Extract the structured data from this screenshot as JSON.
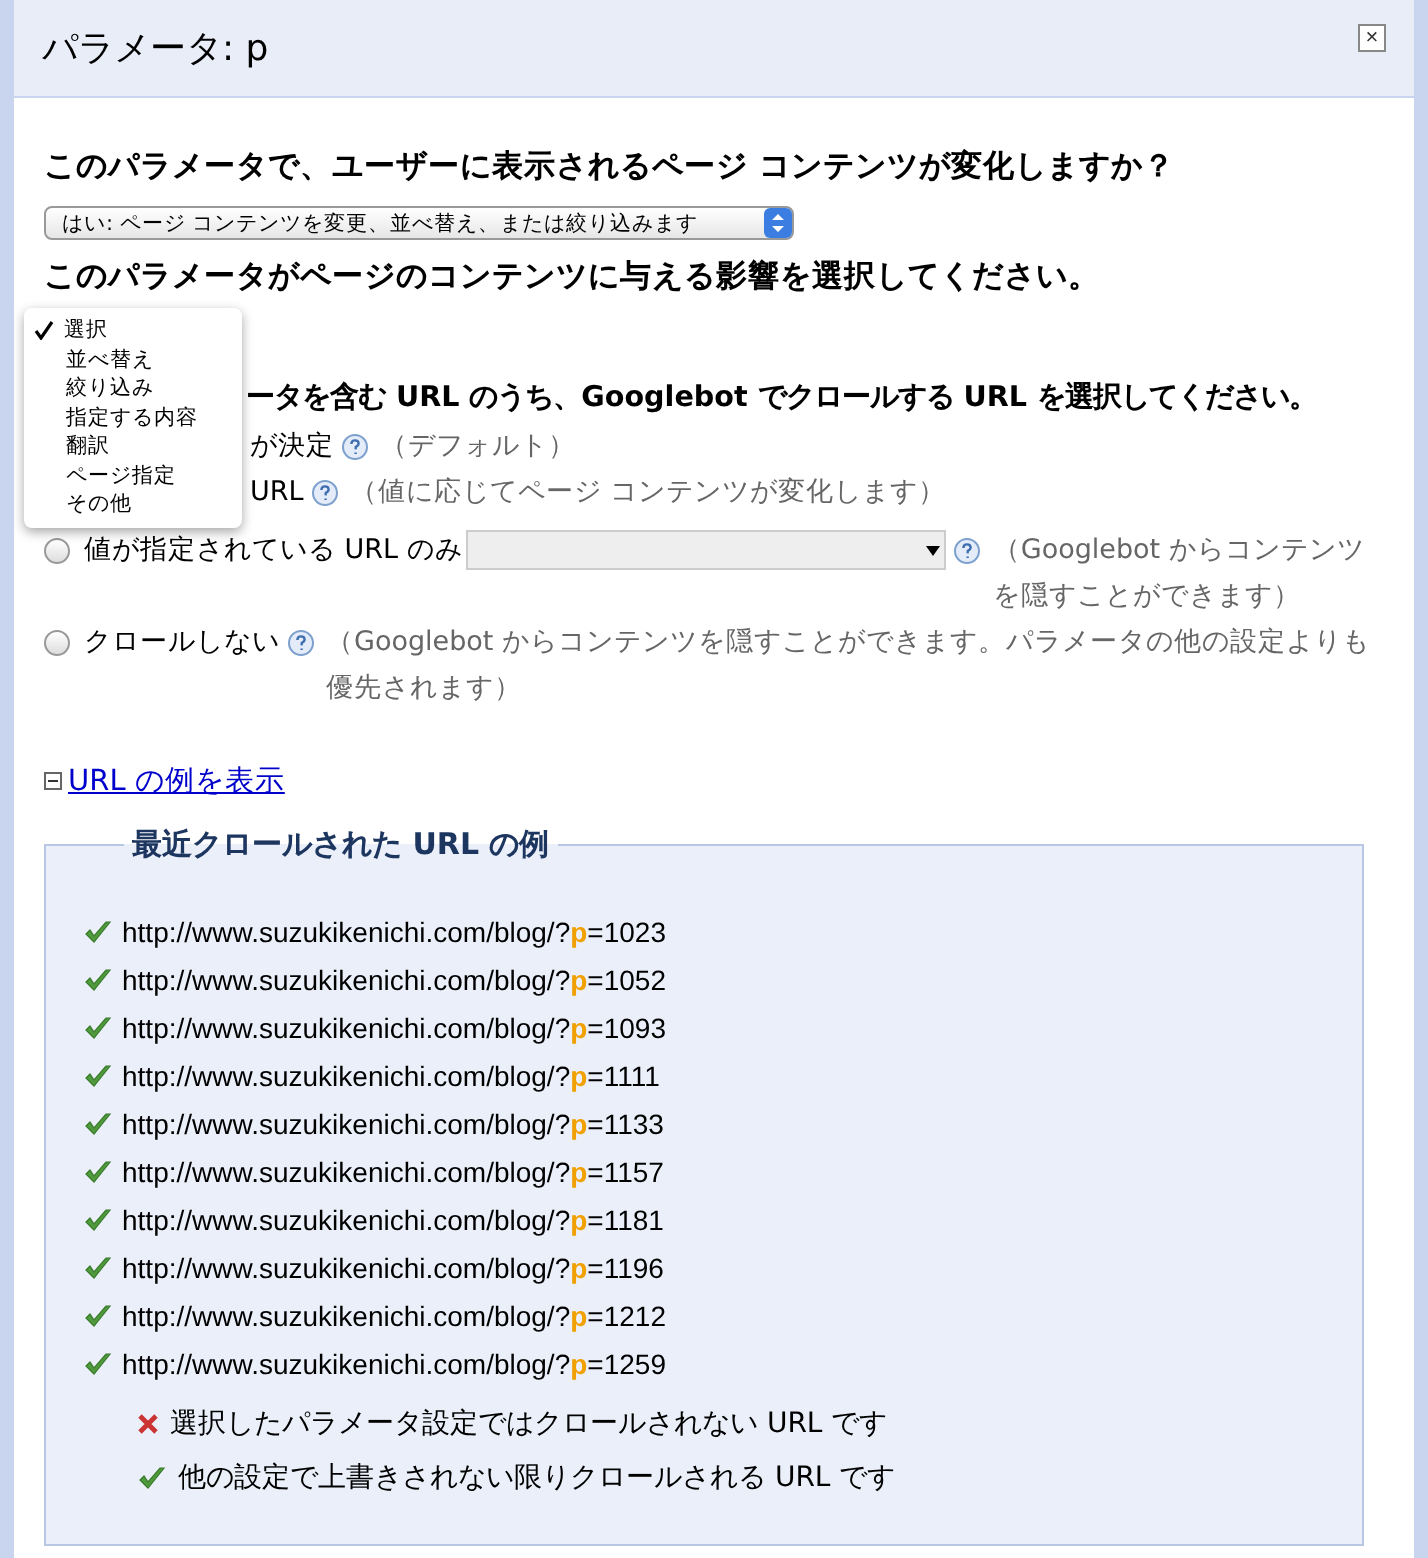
{
  "dialog": {
    "title": "パラメータ: p",
    "close_label": "×"
  },
  "question_1": {
    "text": "このパラメータで、ユーザーに表示されるページ コンテンツが変化しますか？",
    "select_value": "はい: ページ コンテンツを変更、並べ替え、または絞り込みます"
  },
  "question_2": {
    "text": "このパラメータがページのコンテンツに与える影響を選択してください。"
  },
  "effect_menu": [
    {
      "label": "選択",
      "selected": true
    },
    {
      "label": "並べ替え",
      "selected": false
    },
    {
      "label": "絞り込み",
      "selected": false
    },
    {
      "label": "指定する内容",
      "selected": false
    },
    {
      "label": "翻訳",
      "selected": false
    },
    {
      "label": "ページ指定",
      "selected": false
    },
    {
      "label": "その他",
      "selected": false
    }
  ],
  "question_3": {
    "text": "ータを含む URL のうち、Googlebot でクロールする URL を選択してください。"
  },
  "crawl_options": [
    {
      "kind": "covered",
      "label": "が決定",
      "note": "（デフォルト）"
    },
    {
      "kind": "covered",
      "label": "URL",
      "note": "（値に応じてページ コンテンツが変化します）"
    },
    {
      "kind": "select",
      "label": "値が指定されている URL のみ",
      "note": "（Googlebot からコンテンツを隠すことができます）",
      "selected": false
    },
    {
      "kind": "plain",
      "label": "クロールしない",
      "note": "（Googlebot からコンテンツを隠すことができます。パラメータの他の設定よりも優先されます）",
      "selected": false
    }
  ],
  "examples_link": {
    "label": "URL の例を表示",
    "expanded": true
  },
  "examples": {
    "legend": "最近クロールされた URL の例",
    "urls": [
      {
        "base": "http://www.suzukikenichi.com/blog/?",
        "param": "p",
        "value": "=1023",
        "crawled": true
      },
      {
        "base": "http://www.suzukikenichi.com/blog/?",
        "param": "p",
        "value": "=1052",
        "crawled": true
      },
      {
        "base": "http://www.suzukikenichi.com/blog/?",
        "param": "p",
        "value": "=1093",
        "crawled": true
      },
      {
        "base": "http://www.suzukikenichi.com/blog/?",
        "param": "p",
        "value": "=1111",
        "crawled": true
      },
      {
        "base": "http://www.suzukikenichi.com/blog/?",
        "param": "p",
        "value": "=1133",
        "crawled": true
      },
      {
        "base": "http://www.suzukikenichi.com/blog/?",
        "param": "p",
        "value": "=1157",
        "crawled": true
      },
      {
        "base": "http://www.suzukikenichi.com/blog/?",
        "param": "p",
        "value": "=1181",
        "crawled": true
      },
      {
        "base": "http://www.suzukikenichi.com/blog/?",
        "param": "p",
        "value": "=1196",
        "crawled": true
      },
      {
        "base": "http://www.suzukikenichi.com/blog/?",
        "param": "p",
        "value": "=1212",
        "crawled": true
      },
      {
        "base": "http://www.suzukikenichi.com/blog/?",
        "param": "p",
        "value": "=1259",
        "crawled": true
      }
    ],
    "legend_items": [
      {
        "kind": "excluded",
        "text": "選択したパラメータ設定ではクロールされない URL です"
      },
      {
        "kind": "crawled",
        "text": "他の設定で上書きされない限りクロールされる URL です"
      }
    ]
  }
}
